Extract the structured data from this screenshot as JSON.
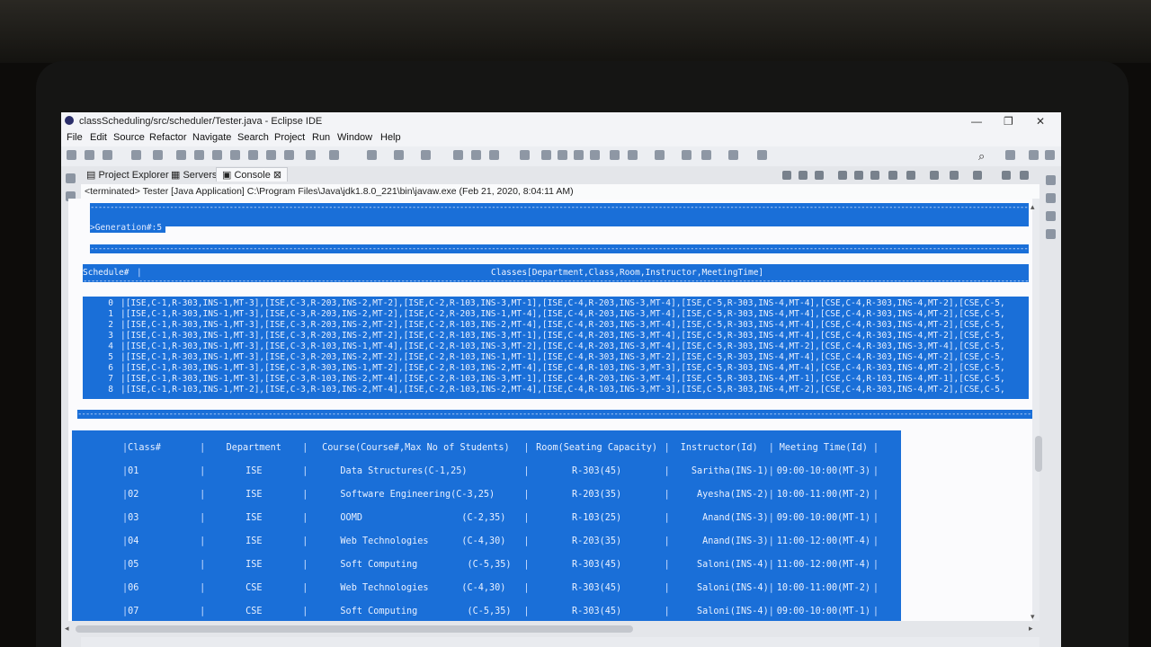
{
  "window": {
    "title": "classScheduling/src/scheduler/Tester.java - Eclipse IDE",
    "controls": [
      "—",
      "❐",
      "✕"
    ]
  },
  "menu": [
    "File",
    "Edit",
    "Source",
    "Refactor",
    "Navigate",
    "Search",
    "Project",
    "Run",
    "Window",
    "Help"
  ],
  "views": {
    "tabs": [
      "Project Explorer",
      "Servers",
      "Console"
    ],
    "active": "Console",
    "close_glyph": "⊠"
  },
  "console": {
    "status": "<terminated> Tester [Java Application] C:\\Program Files\\Java\\jdk1.8.0_221\\bin\\javaw.exe (Feb 21, 2020, 8:04:11 AM)",
    "generation": ">Generation#:5",
    "schedule_header": "Schedule#",
    "classes_header": "Classes[Department,Class,Room,Instructor,MeetingTime]",
    "schedule_rows": [
      {
        "idx": "0",
        "text": "|[ISE,C-1,R-303,INS-1,MT-3],[ISE,C-3,R-203,INS-2,MT-2],[ISE,C-2,R-103,INS-3,MT-1],[ISE,C-4,R-203,INS-3,MT-4],[ISE,C-5,R-303,INS-4,MT-4],[CSE,C-4,R-303,INS-4,MT-2],[CSE,C-5,"
      },
      {
        "idx": "1",
        "text": "|[ISE,C-1,R-303,INS-1,MT-3],[ISE,C-3,R-203,INS-2,MT-2],[ISE,C-2,R-203,INS-1,MT-4],[ISE,C-4,R-203,INS-3,MT-4],[ISE,C-5,R-303,INS-4,MT-4],[CSE,C-4,R-303,INS-4,MT-2],[CSE,C-5,"
      },
      {
        "idx": "2",
        "text": "|[ISE,C-1,R-303,INS-1,MT-3],[ISE,C-3,R-203,INS-2,MT-2],[ISE,C-2,R-103,INS-2,MT-4],[ISE,C-4,R-203,INS-3,MT-4],[ISE,C-5,R-303,INS-4,MT-4],[CSE,C-4,R-303,INS-4,MT-2],[CSE,C-5,"
      },
      {
        "idx": "3",
        "text": "|[ISE,C-1,R-303,INS-1,MT-3],[ISE,C-3,R-203,INS-2,MT-2],[ISE,C-2,R-103,INS-3,MT-1],[ISE,C-4,R-203,INS-3,MT-4],[ISE,C-5,R-303,INS-4,MT-4],[CSE,C-4,R-303,INS-4,MT-2],[CSE,C-5,"
      },
      {
        "idx": "4",
        "text": "|[ISE,C-1,R-303,INS-1,MT-3],[ISE,C-3,R-103,INS-1,MT-4],[ISE,C-2,R-103,INS-3,MT-2],[ISE,C-4,R-203,INS-3,MT-4],[ISE,C-5,R-303,INS-4,MT-2],[CSE,C-4,R-303,INS-3,MT-4],[CSE,C-5,"
      },
      {
        "idx": "5",
        "text": "|[ISE,C-1,R-303,INS-1,MT-3],[ISE,C-3,R-203,INS-2,MT-2],[ISE,C-2,R-103,INS-1,MT-1],[ISE,C-4,R-303,INS-3,MT-2],[ISE,C-5,R-303,INS-4,MT-4],[CSE,C-4,R-303,INS-4,MT-2],[CSE,C-5,"
      },
      {
        "idx": "6",
        "text": "|[ISE,C-1,R-303,INS-1,MT-3],[ISE,C-3,R-303,INS-1,MT-2],[ISE,C-2,R-103,INS-2,MT-4],[ISE,C-4,R-103,INS-3,MT-3],[ISE,C-5,R-303,INS-4,MT-4],[CSE,C-4,R-303,INS-4,MT-2],[CSE,C-5,"
      },
      {
        "idx": "7",
        "text": "|[ISE,C-1,R-303,INS-1,MT-3],[ISE,C-3,R-103,INS-2,MT-4],[ISE,C-2,R-103,INS-3,MT-1],[ISE,C-4,R-203,INS-3,MT-4],[ISE,C-5,R-303,INS-4,MT-1],[CSE,C-4,R-103,INS-4,MT-1],[CSE,C-5,"
      },
      {
        "idx": "8",
        "text": "|[ISE,C-1,R-103,INS-1,MT-2],[ISE,C-3,R-103,INS-2,MT-4],[ISE,C-2,R-103,INS-2,MT-4],[ISE,C-4,R-103,INS-3,MT-3],[ISE,C-5,R-303,INS-4,MT-2],[CSE,C-4,R-303,INS-4,MT-2],[CSE,C-5,"
      }
    ],
    "class_table": {
      "headers": [
        "Class#",
        "Department",
        "Course(Course#,Max No of Students)",
        "Room(Seating Capacity)",
        "Instructor(Id)",
        "Meeting Time(Id)"
      ],
      "rows": [
        {
          "num": "01",
          "dept": "ISE",
          "course": "Data Structures",
          "code": "(C-1,25)",
          "room": "R-303(45)",
          "inst": "Saritha(INS-1)",
          "time": "09:00-10:00(MT-3)"
        },
        {
          "num": "02",
          "dept": "ISE",
          "course": "Software Engineering",
          "code": "(C-3,25)",
          "room": "R-203(35)",
          "inst": "Ayesha(INS-2)",
          "time": "10:00-11:00(MT-2)"
        },
        {
          "num": "03",
          "dept": "ISE",
          "course": "OOMD",
          "code": "(C-2,35)",
          "room": "R-103(25)",
          "inst": "Anand(INS-3)",
          "time": "09:00-10:00(MT-1)"
        },
        {
          "num": "04",
          "dept": "ISE",
          "course": "Web Technologies",
          "code": "(C-4,30)",
          "room": "R-203(35)",
          "inst": "Anand(INS-3)",
          "time": "11:00-12:00(MT-4)"
        },
        {
          "num": "05",
          "dept": "ISE",
          "course": "Soft Computing",
          "code": "(C-5,35)",
          "room": "R-303(45)",
          "inst": "Saloni(INS-4)",
          "time": "11:00-12:00(MT-4)"
        },
        {
          "num": "06",
          "dept": "CSE",
          "course": "Web Technologies",
          "code": "(C-4,30)",
          "room": "R-303(45)",
          "inst": "Saloni(INS-4)",
          "time": "10:00-11:00(MT-2)"
        },
        {
          "num": "07",
          "dept": "CSE",
          "course": "Soft Computing",
          "code": "(C-5,35)",
          "room": "R-303(45)",
          "inst": "Saloni(INS-4)",
          "time": "09:00-10:00(MT-1)"
        }
      ]
    },
    "selection_color": "#1a6fd8"
  }
}
